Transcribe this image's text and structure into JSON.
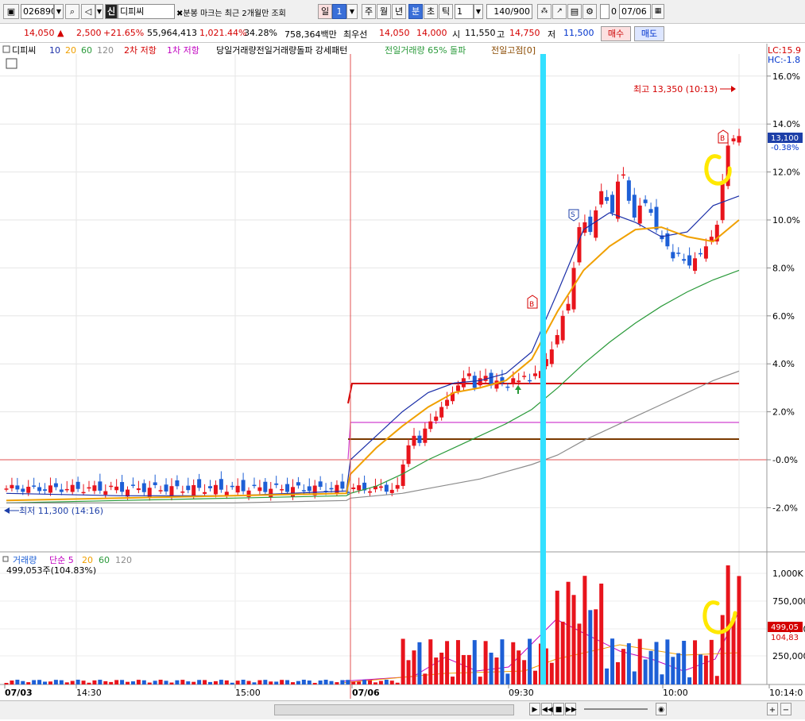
{
  "toolbar": {
    "code": "026890",
    "badge": "신",
    "name": "디피씨",
    "notice": "분봉 마크는 최근 2개월만 조회",
    "period_buttons": [
      "일",
      "1",
      "주",
      "월",
      "년",
      "분",
      "초",
      "틱"
    ],
    "interval": "1",
    "count": "140/900",
    "checkbox_value": "0",
    "date": "07/06"
  },
  "quote": {
    "price": "14,050",
    "change": "2,500",
    "change_pct": "+21.65%",
    "volume": "55,964,413",
    "volume_pct": "1,021.44%",
    "turnover_pct": "34.28%",
    "amount": "758,364백만",
    "best_label": "최우선",
    "ask": "14,050",
    "bid": "14,000",
    "open_label": "시",
    "open": "11,550",
    "high_label": "고",
    "high": "14,750",
    "low_label": "저",
    "low": "11,500",
    "buy_button": "매수",
    "sell_button": "매도"
  },
  "legend": {
    "name": "디피씨",
    "ma": [
      "10",
      "20",
      "60",
      "120"
    ],
    "r2": "2차 저항",
    "r1": "1차 저항",
    "pattern": "당일거래량전일거래량돌파 강세패턴",
    "vol_break": "전일거래량 65% 돌파",
    "prev_high": "전일고점[0]",
    "vol_title": "거래량",
    "vol_simple": "단순 5",
    "vol_ma": [
      "20",
      "60",
      "120"
    ],
    "vol_value": "499,053주(104.83%)"
  },
  "axis": {
    "y_ticks": [
      "16.0%",
      "14.0%",
      "12.0%",
      "10.0%",
      "8.0%",
      "6.0%",
      "4.0%",
      "2.0%",
      "-0.0%",
      "-2.0%"
    ],
    "lc": "LC:15.9",
    "hc": "HC:-1.8",
    "cur_price": "13,100",
    "cur_pct": "-0.38%",
    "vol_ticks": [
      "1,000K",
      "750,000",
      "500,000",
      "250,000"
    ],
    "vol_cur": "499,05",
    "vol_cur_pct": "104,83",
    "x_labels": [
      "07/03",
      "14:30",
      "15:00",
      "07/06",
      "09:30",
      "10:00",
      "10:14:0"
    ]
  },
  "annotations": {
    "high_note": "최고 13,350 (10:13)",
    "low_note": "최저 11,300 (14:16)",
    "buy_mark": "B",
    "sell_mark": "S"
  },
  "colors": {
    "up": "#e8141c",
    "down": "#1d5fd6",
    "ma5": "#1a2ea8",
    "ma20": "#f0a000",
    "ma60": "#2a9a3a",
    "ma120": "#8c8c8c",
    "cursor": "#33e0ff",
    "highlight": "#ffe800"
  },
  "chart_data": {
    "type": "line",
    "title": "",
    "xlabel": "",
    "ylabel": "",
    "ylim": [
      -2.5,
      16.5
    ],
    "x_range": [
      "07/03 14:16",
      "07/06 10:14"
    ],
    "series": [
      {
        "name": "10",
        "values": [
          -1.4,
          -1.5,
          -1.5,
          -1.3,
          0.0,
          1.0,
          2.0,
          2.8,
          3.2,
          3.3,
          3.6,
          4.5,
          7.0,
          9.6,
          10.3,
          9.9,
          9.3,
          9.5,
          10.6,
          11.0
        ]
      },
      {
        "name": "20",
        "values": [
          -1.7,
          -1.6,
          -1.5,
          -1.4,
          -0.6,
          0.5,
          1.4,
          2.2,
          2.8,
          3.0,
          3.3,
          4.2,
          6.2,
          7.9,
          8.9,
          9.6,
          9.7,
          9.3,
          9.1,
          10.0
        ]
      },
      {
        "name": "60",
        "values": [
          -1.8,
          -1.7,
          -1.6,
          -1.5,
          -1.4,
          -1.1,
          -0.6,
          0.0,
          0.5,
          1.0,
          1.5,
          2.1,
          3.0,
          4.0,
          4.9,
          5.7,
          6.4,
          7.0,
          7.5,
          7.9
        ]
      },
      {
        "name": "120",
        "values": [
          -1.8,
          -1.8,
          -1.8,
          -1.7,
          -1.6,
          -1.5,
          -1.4,
          -1.2,
          -1.0,
          -0.8,
          -0.5,
          -0.2,
          0.2,
          0.8,
          1.3,
          1.8,
          2.3,
          2.8,
          3.3,
          3.7
        ]
      }
    ],
    "resistance_levels": {
      "2차 저항": 3.2,
      "1차 저항": 1.5,
      "전일고점": 0.9
    },
    "price_high": 13350,
    "price_low": 11300,
    "current_pct": 13.1
  }
}
